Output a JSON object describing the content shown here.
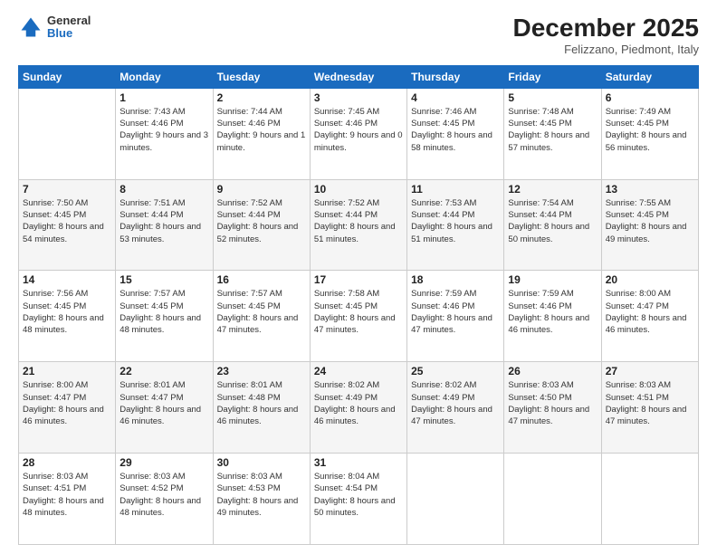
{
  "logo": {
    "general": "General",
    "blue": "Blue"
  },
  "title": "December 2025",
  "subtitle": "Felizzano, Piedmont, Italy",
  "days_of_week": [
    "Sunday",
    "Monday",
    "Tuesday",
    "Wednesday",
    "Thursday",
    "Friday",
    "Saturday"
  ],
  "weeks": [
    [
      {
        "day": "",
        "sunrise": "",
        "sunset": "",
        "daylight": ""
      },
      {
        "day": "1",
        "sunrise": "Sunrise: 7:43 AM",
        "sunset": "Sunset: 4:46 PM",
        "daylight": "Daylight: 9 hours and 3 minutes."
      },
      {
        "day": "2",
        "sunrise": "Sunrise: 7:44 AM",
        "sunset": "Sunset: 4:46 PM",
        "daylight": "Daylight: 9 hours and 1 minute."
      },
      {
        "day": "3",
        "sunrise": "Sunrise: 7:45 AM",
        "sunset": "Sunset: 4:46 PM",
        "daylight": "Daylight: 9 hours and 0 minutes."
      },
      {
        "day": "4",
        "sunrise": "Sunrise: 7:46 AM",
        "sunset": "Sunset: 4:45 PM",
        "daylight": "Daylight: 8 hours and 58 minutes."
      },
      {
        "day": "5",
        "sunrise": "Sunrise: 7:48 AM",
        "sunset": "Sunset: 4:45 PM",
        "daylight": "Daylight: 8 hours and 57 minutes."
      },
      {
        "day": "6",
        "sunrise": "Sunrise: 7:49 AM",
        "sunset": "Sunset: 4:45 PM",
        "daylight": "Daylight: 8 hours and 56 minutes."
      }
    ],
    [
      {
        "day": "7",
        "sunrise": "Sunrise: 7:50 AM",
        "sunset": "Sunset: 4:45 PM",
        "daylight": "Daylight: 8 hours and 54 minutes."
      },
      {
        "day": "8",
        "sunrise": "Sunrise: 7:51 AM",
        "sunset": "Sunset: 4:44 PM",
        "daylight": "Daylight: 8 hours and 53 minutes."
      },
      {
        "day": "9",
        "sunrise": "Sunrise: 7:52 AM",
        "sunset": "Sunset: 4:44 PM",
        "daylight": "Daylight: 8 hours and 52 minutes."
      },
      {
        "day": "10",
        "sunrise": "Sunrise: 7:52 AM",
        "sunset": "Sunset: 4:44 PM",
        "daylight": "Daylight: 8 hours and 51 minutes."
      },
      {
        "day": "11",
        "sunrise": "Sunrise: 7:53 AM",
        "sunset": "Sunset: 4:44 PM",
        "daylight": "Daylight: 8 hours and 51 minutes."
      },
      {
        "day": "12",
        "sunrise": "Sunrise: 7:54 AM",
        "sunset": "Sunset: 4:44 PM",
        "daylight": "Daylight: 8 hours and 50 minutes."
      },
      {
        "day": "13",
        "sunrise": "Sunrise: 7:55 AM",
        "sunset": "Sunset: 4:45 PM",
        "daylight": "Daylight: 8 hours and 49 minutes."
      }
    ],
    [
      {
        "day": "14",
        "sunrise": "Sunrise: 7:56 AM",
        "sunset": "Sunset: 4:45 PM",
        "daylight": "Daylight: 8 hours and 48 minutes."
      },
      {
        "day": "15",
        "sunrise": "Sunrise: 7:57 AM",
        "sunset": "Sunset: 4:45 PM",
        "daylight": "Daylight: 8 hours and 48 minutes."
      },
      {
        "day": "16",
        "sunrise": "Sunrise: 7:57 AM",
        "sunset": "Sunset: 4:45 PM",
        "daylight": "Daylight: 8 hours and 47 minutes."
      },
      {
        "day": "17",
        "sunrise": "Sunrise: 7:58 AM",
        "sunset": "Sunset: 4:45 PM",
        "daylight": "Daylight: 8 hours and 47 minutes."
      },
      {
        "day": "18",
        "sunrise": "Sunrise: 7:59 AM",
        "sunset": "Sunset: 4:46 PM",
        "daylight": "Daylight: 8 hours and 47 minutes."
      },
      {
        "day": "19",
        "sunrise": "Sunrise: 7:59 AM",
        "sunset": "Sunset: 4:46 PM",
        "daylight": "Daylight: 8 hours and 46 minutes."
      },
      {
        "day": "20",
        "sunrise": "Sunrise: 8:00 AM",
        "sunset": "Sunset: 4:47 PM",
        "daylight": "Daylight: 8 hours and 46 minutes."
      }
    ],
    [
      {
        "day": "21",
        "sunrise": "Sunrise: 8:00 AM",
        "sunset": "Sunset: 4:47 PM",
        "daylight": "Daylight: 8 hours and 46 minutes."
      },
      {
        "day": "22",
        "sunrise": "Sunrise: 8:01 AM",
        "sunset": "Sunset: 4:47 PM",
        "daylight": "Daylight: 8 hours and 46 minutes."
      },
      {
        "day": "23",
        "sunrise": "Sunrise: 8:01 AM",
        "sunset": "Sunset: 4:48 PM",
        "daylight": "Daylight: 8 hours and 46 minutes."
      },
      {
        "day": "24",
        "sunrise": "Sunrise: 8:02 AM",
        "sunset": "Sunset: 4:49 PM",
        "daylight": "Daylight: 8 hours and 46 minutes."
      },
      {
        "day": "25",
        "sunrise": "Sunrise: 8:02 AM",
        "sunset": "Sunset: 4:49 PM",
        "daylight": "Daylight: 8 hours and 47 minutes."
      },
      {
        "day": "26",
        "sunrise": "Sunrise: 8:03 AM",
        "sunset": "Sunset: 4:50 PM",
        "daylight": "Daylight: 8 hours and 47 minutes."
      },
      {
        "day": "27",
        "sunrise": "Sunrise: 8:03 AM",
        "sunset": "Sunset: 4:51 PM",
        "daylight": "Daylight: 8 hours and 47 minutes."
      }
    ],
    [
      {
        "day": "28",
        "sunrise": "Sunrise: 8:03 AM",
        "sunset": "Sunset: 4:51 PM",
        "daylight": "Daylight: 8 hours and 48 minutes."
      },
      {
        "day": "29",
        "sunrise": "Sunrise: 8:03 AM",
        "sunset": "Sunset: 4:52 PM",
        "daylight": "Daylight: 8 hours and 48 minutes."
      },
      {
        "day": "30",
        "sunrise": "Sunrise: 8:03 AM",
        "sunset": "Sunset: 4:53 PM",
        "daylight": "Daylight: 8 hours and 49 minutes."
      },
      {
        "day": "31",
        "sunrise": "Sunrise: 8:04 AM",
        "sunset": "Sunset: 4:54 PM",
        "daylight": "Daylight: 8 hours and 50 minutes."
      },
      {
        "day": "",
        "sunrise": "",
        "sunset": "",
        "daylight": ""
      },
      {
        "day": "",
        "sunrise": "",
        "sunset": "",
        "daylight": ""
      },
      {
        "day": "",
        "sunrise": "",
        "sunset": "",
        "daylight": ""
      }
    ]
  ]
}
